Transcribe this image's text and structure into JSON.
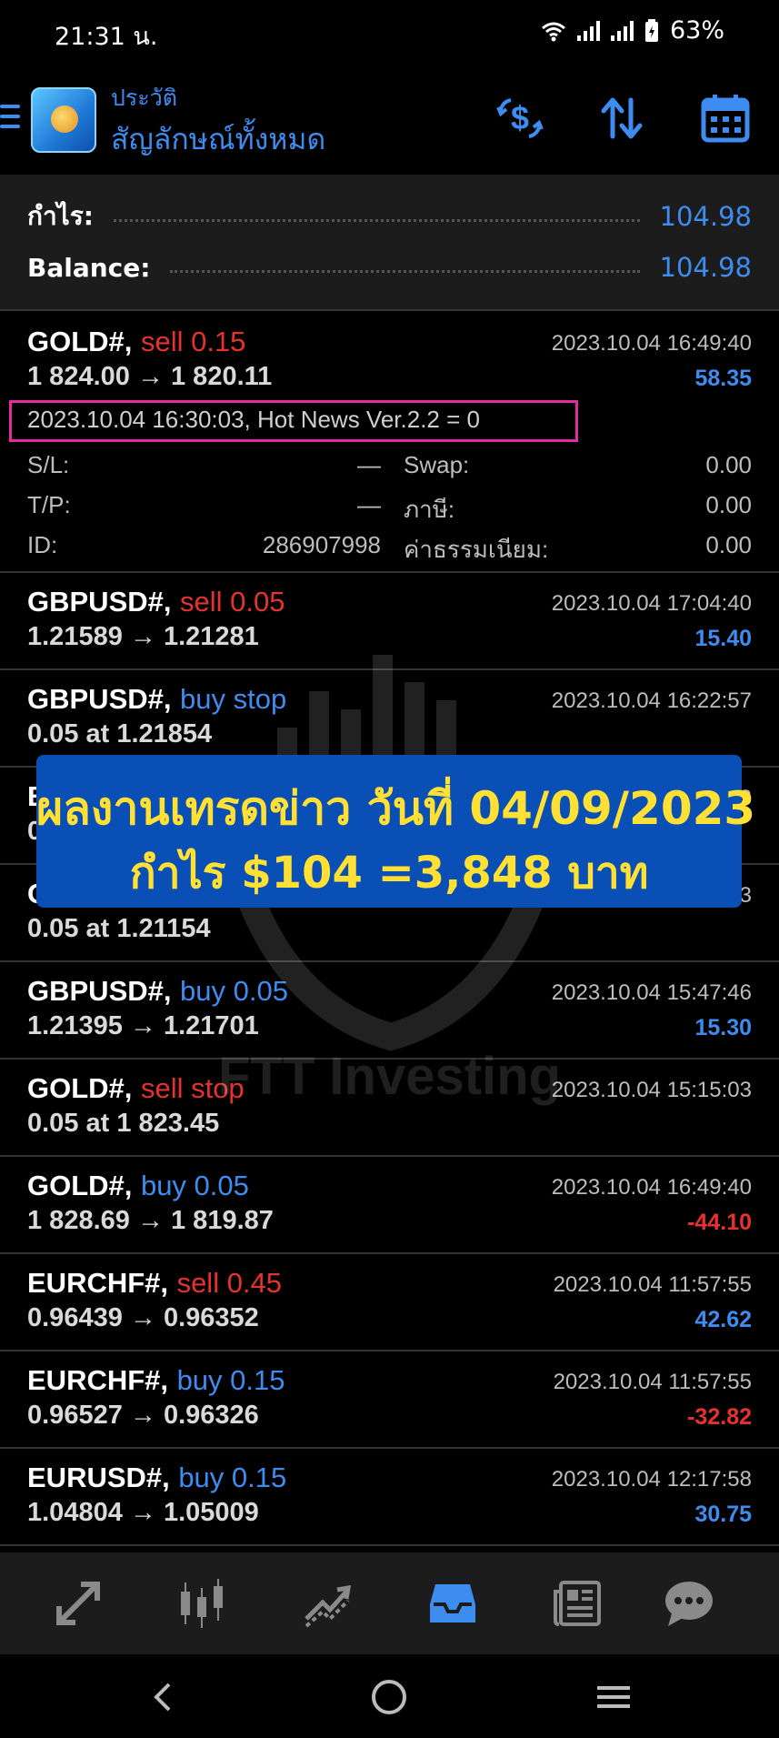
{
  "status_bar": {
    "time": "21:31 น.",
    "battery": "63%"
  },
  "header": {
    "subtitle": "ประวัติ",
    "title": "สัญลักษณ์ทั้งหมด"
  },
  "summary": {
    "profit_label": "กำไร:",
    "profit_value": "104.98",
    "balance_label": "Balance:",
    "balance_value": "104.98"
  },
  "trades": [
    {
      "symbol": "GOLD#,",
      "type": "sell 0.15",
      "prices": "1 824.00 → 1 820.11",
      "time": "2023.10.04 16:49:40",
      "profit": "58.35",
      "comment": "2023.10.04 16:30:03, Hot News Ver.2.2 = 0",
      "details": {
        "sl_label": "S/L:",
        "sl_value": "—",
        "swap_label": "Swap:",
        "swap_value": "0.00",
        "tp_label": "T/P:",
        "tp_value": "—",
        "tax_label": "ภาษี:",
        "tax_value": "0.00",
        "id_label": "ID:",
        "id_value": "286907998",
        "fee_label": "ค่าธรรมเนียม:",
        "fee_value": "0.00"
      }
    },
    {
      "symbol": "GBPUSD#,",
      "type": "sell 0.05",
      "prices": "1.21589 → 1.21281",
      "time": "2023.10.04 17:04:40",
      "profit": "15.40"
    },
    {
      "symbol": "GBPUSD#,",
      "type": "buy stop",
      "prices": "0.05 at 1.21854",
      "time": "2023.10.04 16:22:57",
      "profit": ""
    },
    {
      "symbol": "E",
      "type": "",
      "prices": "0",
      "time": "3",
      "profit": ""
    },
    {
      "symbol": "G",
      "type": "",
      "prices": "0.05 at 1.21154",
      "time": "3",
      "profit": ""
    },
    {
      "symbol": "GBPUSD#,",
      "type": "buy 0.05",
      "prices": "1.21395 → 1.21701",
      "time": "2023.10.04 15:47:46",
      "profit": "15.30"
    },
    {
      "symbol": "GOLD#,",
      "type": "sell stop",
      "prices": "0.05 at 1 823.45",
      "time": "2023.10.04 15:15:03",
      "profit": ""
    },
    {
      "symbol": "GOLD#,",
      "type": "buy 0.05",
      "prices": "1 828.69 → 1 819.87",
      "time": "2023.10.04 16:49:40",
      "profit": "-44.10"
    },
    {
      "symbol": "EURCHF#,",
      "type": "sell 0.45",
      "prices": "0.96439 → 0.96352",
      "time": "2023.10.04 11:57:55",
      "profit": "42.62"
    },
    {
      "symbol": "EURCHF#,",
      "type": "buy 0.15",
      "prices": "0.96527 → 0.96326",
      "time": "2023.10.04 11:57:55",
      "profit": "-32.82"
    },
    {
      "symbol": "EURUSD#,",
      "type": "buy 0.15",
      "prices": "1.04804 → 1.05009",
      "time": "2023.10.04 12:17:58",
      "profit": "30.75"
    }
  ],
  "banner": {
    "line1": "ผลงานเทรดข่าว วันที่ 04/09/2023",
    "line2": "กำไร $104 =3,848 บาท"
  },
  "watermark": "FTT Investing",
  "colors": {
    "accent_blue": "#3d8cf0",
    "sell_red": "#e8312f",
    "banner_bg": "#0a4fb6",
    "banner_text": "#ffe033",
    "highlight_pink": "#e52aa0"
  },
  "icons": {
    "header": [
      "menu-icon",
      "currency-exchange-icon",
      "sort-icon",
      "calendar-icon"
    ],
    "bottom_nav": [
      "quotes-icon",
      "chart-icon",
      "trade-icon",
      "history-icon",
      "news-icon",
      "chat-icon"
    ],
    "active_tab": "history-icon"
  }
}
